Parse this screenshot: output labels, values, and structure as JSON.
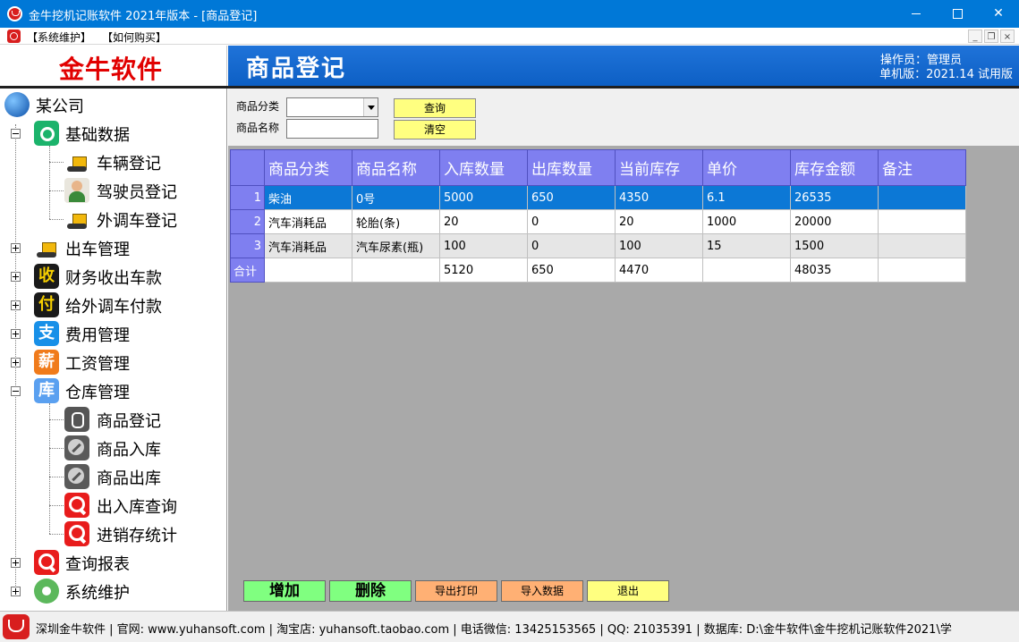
{
  "window": {
    "title": "金牛挖机记账软件 2021年版本 - [商品登记]"
  },
  "menu": {
    "items": [
      "【系统维护】",
      "【如何购买】"
    ],
    "mdi_min": "_",
    "mdi_restore": "❐",
    "mdi_close": "×"
  },
  "brand": {
    "name": "金牛软件"
  },
  "header": {
    "page_title": "商品登记",
    "operator": "操作员：管理员",
    "version": "单机版：2021.14 试用版"
  },
  "tree": {
    "root": "某公司",
    "nodes": [
      {
        "label": "基础数据",
        "icon": "base-data-icon",
        "expanded": true
      },
      {
        "label": "车辆登记",
        "icon": "excavator-icon"
      },
      {
        "label": "驾驶员登记",
        "icon": "driver-icon"
      },
      {
        "label": "外调车登记",
        "icon": "excavator-icon"
      },
      {
        "label": "出车管理",
        "icon": "excavator-icon",
        "expanded": false
      },
      {
        "label": "财务收出车款",
        "icon": "receive-icon",
        "glyph": "收",
        "expanded": false
      },
      {
        "label": "给外调车付款",
        "icon": "pay-icon",
        "glyph": "付",
        "expanded": false
      },
      {
        "label": "费用管理",
        "icon": "expense-icon",
        "glyph": "支",
        "expanded": false
      },
      {
        "label": "工资管理",
        "icon": "salary-icon",
        "glyph": "薪",
        "expanded": false
      },
      {
        "label": "仓库管理",
        "icon": "warehouse-icon",
        "glyph": "库",
        "expanded": true
      },
      {
        "label": "商品登记",
        "icon": "tools-icon"
      },
      {
        "label": "商品入库",
        "icon": "wrench-icon"
      },
      {
        "label": "商品出库",
        "icon": "wrench-icon"
      },
      {
        "label": "出入库查询",
        "icon": "search-icon"
      },
      {
        "label": "进销存统计",
        "icon": "search-icon"
      },
      {
        "label": "查询报表",
        "icon": "search-icon",
        "expanded": false
      },
      {
        "label": "系统维护",
        "icon": "gear-icon",
        "expanded": false
      }
    ]
  },
  "filter": {
    "category_label": "商品分类",
    "name_label": "商品名称",
    "category_value": "",
    "name_value": "",
    "query_button": "查询",
    "clear_button": "清空"
  },
  "grid": {
    "columns": [
      "商品分类",
      "商品名称",
      "入库数量",
      "出库数量",
      "当前库存",
      "单价",
      "库存金额",
      "备注"
    ],
    "rows": [
      {
        "num": "1",
        "cells": [
          "柴油",
          "0号",
          "5000",
          "650",
          "4350",
          "6.1",
          "26535",
          ""
        ]
      },
      {
        "num": "2",
        "cells": [
          "汽车消耗品",
          "轮胎(条)",
          "20",
          "0",
          "20",
          "1000",
          "20000",
          ""
        ]
      },
      {
        "num": "3",
        "cells": [
          "汽车消耗品",
          "汽车尿素(瓶)",
          "100",
          "0",
          "100",
          "15",
          "1500",
          ""
        ]
      }
    ],
    "total": {
      "label": "合计",
      "cells": [
        "",
        "",
        "5120",
        "650",
        "4470",
        "",
        "48035",
        ""
      ]
    }
  },
  "actions": {
    "add": "增加",
    "delete": "删除",
    "export_print": "导出打印",
    "import": "导入数据",
    "exit": "退出"
  },
  "status": {
    "text": "深圳金牛软件 | 官网: www.yuhansoft.com | 淘宝店: yuhansoft.taobao.com | 电话微信: 13425153565 | QQ: 21035391 | 数据库: D:\\金牛软件\\金牛挖机记账软件2021\\学"
  },
  "colors": {
    "titlebar": "#0078d7",
    "header": "#1f73d9",
    "grid_header": "#7f7ff0",
    "selected_row": "#0c78d6",
    "brand_red": "#e10000"
  }
}
